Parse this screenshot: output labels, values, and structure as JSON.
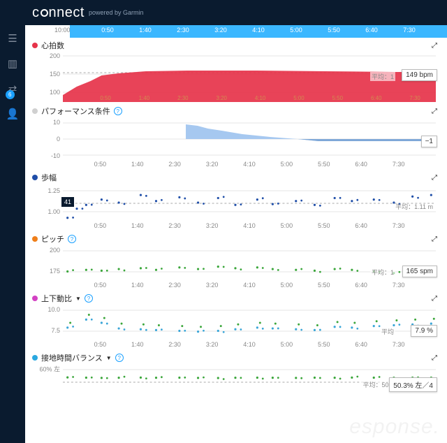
{
  "header": {
    "brand_prefix": "c",
    "brand_mid": "nnect",
    "powered": "powered by Garmin"
  },
  "sidebar": {
    "badge": "6"
  },
  "time_axis": {
    "start_label": "10:00",
    "ticks": [
      "0:50",
      "1:40",
      "2:30",
      "3:20",
      "4:10",
      "5:00",
      "5:50",
      "6:40",
      "7:30"
    ]
  },
  "charts": [
    {
      "id": "hr",
      "title": "心拍数",
      "color": "#e6334a",
      "expand": "⤢",
      "yticks": [
        "200",
        "150",
        "100"
      ],
      "avg_label": "平均：1",
      "value_pill": "149 bpm"
    },
    {
      "id": "perf",
      "title": "パフォーマンス条件",
      "color": "#d0d0d0",
      "help": true,
      "expand": "⤢",
      "yticks": [
        "10",
        "0",
        "-10"
      ],
      "value_pill": "−1"
    },
    {
      "id": "stride",
      "title": "歩幅",
      "color": "#1f4ea8",
      "expand": "⤢",
      "mini": "41",
      "yticks": [
        "1.25",
        "1.00"
      ],
      "avg_label": "平均：1.11 m"
    },
    {
      "id": "cadence",
      "title": "ピッチ",
      "color": "#ef7f1a",
      "help": true,
      "expand": "⤢",
      "yticks": [
        "200",
        "175"
      ],
      "avg_label": "平均：1",
      "value_pill": "165 spm"
    },
    {
      "id": "vo",
      "title": "上下動比",
      "color": "#d341c3",
      "help": true,
      "caret": "▼",
      "expand": "⤢",
      "yticks": [
        "10.0",
        "7.5"
      ],
      "avg_label": "平均",
      "value_pill": "7.9 %"
    },
    {
      "id": "gct",
      "title": "接地時間バランス",
      "color": "#2aa8e0",
      "help": true,
      "caret": "▼",
      "expand": "⤢",
      "yticks": [
        "60% 左"
      ],
      "avg_label": "平均：50.2",
      "value_pill": "50.3% 左／4"
    }
  ],
  "chart_data": [
    {
      "type": "area",
      "title": "心拍数",
      "ylabel": "bpm",
      "ylim": [
        60,
        200
      ],
      "x": [
        0,
        0.4,
        0.83,
        1.67,
        2.5,
        3.33,
        4.17,
        5.0,
        5.83,
        6.67,
        7.5,
        8.0
      ],
      "y": [
        75,
        110,
        135,
        147,
        152,
        153,
        153,
        152,
        150,
        150,
        150,
        150
      ],
      "xticks": [
        "0:50",
        "1:40",
        "2:30",
        "3:20",
        "4:10",
        "5:00",
        "5:50",
        "6:40",
        "7:30"
      ],
      "mean": 149,
      "mean_label": "149 bpm"
    },
    {
      "type": "area",
      "title": "パフォーマンス条件",
      "ylabel": "",
      "ylim": [
        -10,
        10
      ],
      "x": [
        2.65,
        2.9,
        3.33,
        4.17,
        5.0,
        5.5,
        5.83,
        6.67,
        7.5,
        8.0
      ],
      "y": [
        7,
        6,
        4,
        2,
        0,
        -1,
        -1,
        -1,
        -1,
        -1
      ],
      "xticks": [
        "0:50",
        "1:40",
        "2:30",
        "3:20",
        "4:10",
        "5:00",
        "5:50",
        "6:40",
        "7:30"
      ],
      "last": -1
    },
    {
      "type": "scatter",
      "title": "歩幅",
      "ylabel": "m",
      "ylim": [
        0.85,
        1.3
      ],
      "x": [
        0.1,
        0.3,
        0.5,
        0.83,
        1.2,
        1.67,
        2.0,
        2.5,
        2.9,
        3.33,
        3.7,
        4.17,
        4.5,
        5.0,
        5.4,
        5.83,
        6.2,
        6.67,
        7.1,
        7.5,
        7.9
      ],
      "y": [
        0.88,
        1.0,
        1.05,
        1.12,
        1.08,
        1.18,
        1.1,
        1.15,
        1.08,
        1.14,
        1.05,
        1.12,
        1.06,
        1.1,
        1.05,
        1.14,
        1.1,
        1.12,
        1.08,
        1.16,
        1.18
      ],
      "xticks": [
        "0:50",
        "1:40",
        "2:30",
        "3:20",
        "4:10",
        "5:00",
        "5:50",
        "6:40",
        "7:30"
      ],
      "mean": 1.11,
      "mean_label": "平均：1.11 m"
    },
    {
      "type": "scatter",
      "title": "ピッチ",
      "ylabel": "spm",
      "ylim": [
        160,
        200
      ],
      "x": [
        0.1,
        0.5,
        0.83,
        1.2,
        1.67,
        2.0,
        2.5,
        2.9,
        3.33,
        3.7,
        4.17,
        4.5,
        5.0,
        5.4,
        5.83,
        6.2,
        6.67,
        7.1,
        7.5,
        7.9
      ],
      "y": [
        170,
        172,
        171,
        173,
        174,
        172,
        175,
        173,
        176,
        174,
        175,
        173,
        172,
        171,
        173,
        172,
        170,
        168,
        166,
        165
      ],
      "xticks": [
        "0:50",
        "1:40",
        "2:30",
        "3:20",
        "4:10",
        "5:00",
        "5:50",
        "6:40",
        "7:30"
      ],
      "last": 165,
      "last_label": "165 spm"
    },
    {
      "type": "scatter",
      "title": "上下動比",
      "ylabel": "%",
      "ylim": [
        6.0,
        10.0
      ],
      "x": [
        0.1,
        0.5,
        0.83,
        1.2,
        1.67,
        2.0,
        2.5,
        2.9,
        3.33,
        3.7,
        4.17,
        4.5,
        5.0,
        5.4,
        5.83,
        6.2,
        6.67,
        7.1,
        7.5,
        7.9
      ],
      "y": [
        7.4,
        8.4,
        8.0,
        7.3,
        7.2,
        7.1,
        7.0,
        6.9,
        7.0,
        7.2,
        7.4,
        7.3,
        7.2,
        7.1,
        7.5,
        7.4,
        7.6,
        7.7,
        7.8,
        7.9
      ],
      "xticks": [
        "0:50",
        "1:40",
        "2:30",
        "3:20",
        "4:10",
        "5:00",
        "5:50",
        "6:40",
        "7:30"
      ],
      "last": 7.9,
      "last_label": "7.9 %"
    },
    {
      "type": "scatter",
      "title": "接地時間バランス",
      "ylabel": "% 左",
      "ylim": [
        40,
        60
      ],
      "x": [
        0.1,
        0.5,
        0.83,
        1.2,
        1.67,
        2.0,
        2.5,
        2.9,
        3.33,
        3.7,
        4.17,
        4.5,
        5.0,
        5.4,
        5.83,
        6.2,
        6.67,
        7.1,
        7.5,
        7.9
      ],
      "y": [
        50.5,
        50.3,
        50.1,
        50.2,
        50.4,
        50.2,
        50.3,
        50.1,
        50.0,
        50.2,
        50.3,
        50.2,
        50.1,
        50.3,
        50.2,
        50.4,
        50.3,
        50.2,
        50.3,
        50.3
      ],
      "xticks": [
        "0:50",
        "1:40",
        "2:30",
        "3:20",
        "4:10",
        "5:00",
        "5:50",
        "6:40",
        "7:30"
      ],
      "mean": 50.2,
      "last": 50.3,
      "last_label": "50.3% 左／4"
    }
  ],
  "watermark": "esponse."
}
